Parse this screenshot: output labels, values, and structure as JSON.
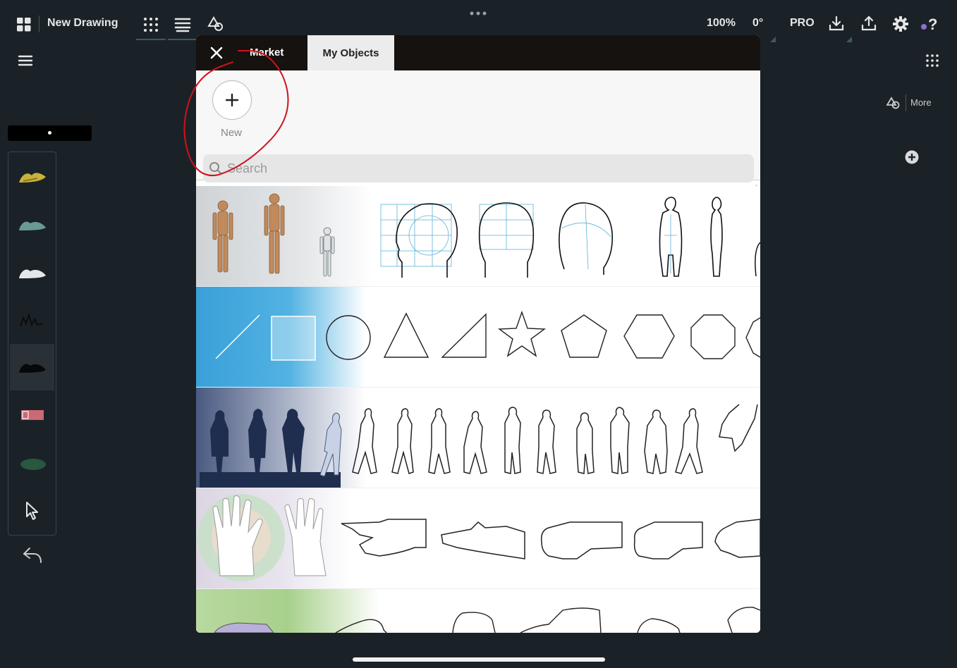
{
  "toolbar": {
    "title": "New Drawing",
    "zoom": "100%",
    "rotation": "0°",
    "pro_label": "PRO"
  },
  "right_panel": {
    "more_label": "More"
  },
  "modal": {
    "tabs": [
      {
        "label": "Market"
      },
      {
        "label": "My Objects"
      }
    ],
    "new_label": "New",
    "search_placeholder": "Search",
    "rows": [
      {
        "category": "figures"
      },
      {
        "category": "shapes"
      },
      {
        "category": "people"
      },
      {
        "category": "hands"
      },
      {
        "category": "shoes"
      }
    ]
  },
  "colors": {
    "background": "#1b2227",
    "annotation": "#d0121b",
    "accent_dot": "#8c6fd6"
  }
}
